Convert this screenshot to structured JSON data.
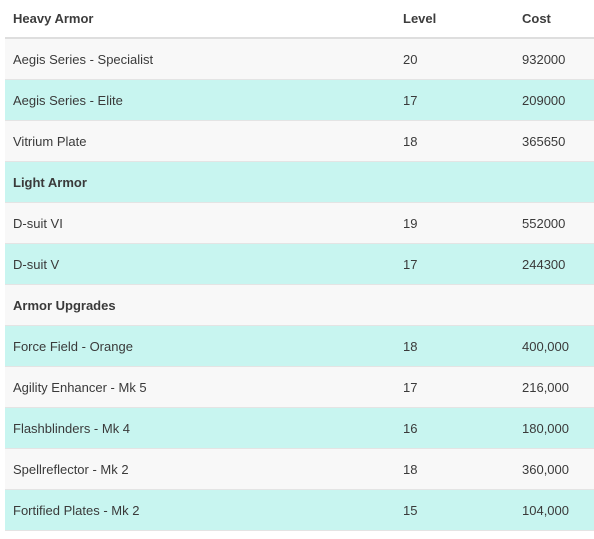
{
  "table": {
    "headers": {
      "name": "Heavy Armor",
      "level": "Level",
      "cost": "Cost"
    },
    "rows": [
      {
        "type": "item",
        "name": "Aegis Series - Specialist",
        "level": "20",
        "cost": "932000",
        "shade": "white"
      },
      {
        "type": "item",
        "name": "Aegis Series - Elite",
        "level": "17",
        "cost": "209000",
        "shade": "teal"
      },
      {
        "type": "item",
        "name": "Vitrium Plate",
        "level": "18",
        "cost": "365650",
        "shade": "white"
      },
      {
        "type": "section",
        "name": "Light Armor",
        "level": "",
        "cost": "",
        "shade": "teal"
      },
      {
        "type": "item",
        "name": "D-suit VI",
        "level": "19",
        "cost": "552000",
        "shade": "white"
      },
      {
        "type": "item",
        "name": "D-suit V",
        "level": "17",
        "cost": "244300",
        "shade": "teal"
      },
      {
        "type": "section",
        "name": "Armor Upgrades",
        "level": "",
        "cost": "",
        "shade": "white"
      },
      {
        "type": "item",
        "name": "Force Field - Orange",
        "level": "18",
        "cost": "400,000",
        "shade": "teal"
      },
      {
        "type": "item",
        "name": "Agility Enhancer - Mk 5",
        "level": "17",
        "cost": "216,000",
        "shade": "white"
      },
      {
        "type": "item",
        "name": "Flashblinders - Mk 4",
        "level": "16",
        "cost": "180,000",
        "shade": "teal"
      },
      {
        "type": "item",
        "name": "Spellreflector - Mk 2",
        "level": "18",
        "cost": "360,000",
        "shade": "white"
      },
      {
        "type": "item",
        "name": "Fortified Plates - Mk 2",
        "level": "15",
        "cost": "104,000",
        "shade": "teal"
      }
    ]
  },
  "colors": {
    "row_white": "#f8f8f8",
    "row_teal": "#c8f5f0",
    "text": "#3a3a3a",
    "header_border": "#dedede"
  }
}
